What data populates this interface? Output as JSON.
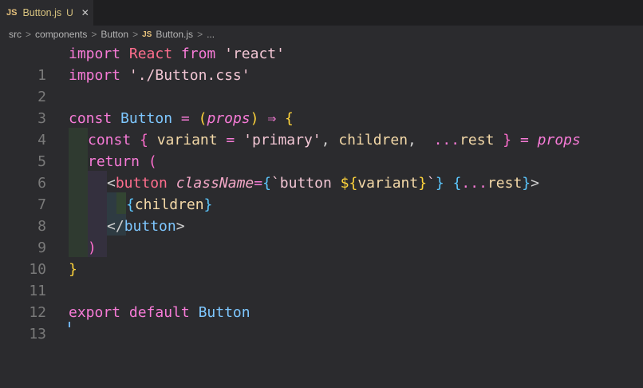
{
  "tab": {
    "badge": "JS",
    "label": "Button.js",
    "status": "U",
    "close": "✕"
  },
  "breadcrumb": [
    "src",
    "components",
    "Button"
  ],
  "breadcrumb_file": {
    "badge": "JS",
    "label": "Button.js",
    "tail": "..."
  },
  "line_numbers": [
    "1",
    "2",
    "3",
    "4",
    "5",
    "6",
    "7",
    "8",
    "9",
    "10",
    "11",
    "12",
    "13"
  ],
  "code": {
    "l1": {
      "import": "import",
      "react": "React",
      "from": "from",
      "mod": "'react'"
    },
    "l2": {
      "import": "import",
      "mod": "'./Button.css'"
    },
    "l4": {
      "const": "const",
      "name": "Button",
      "eq": "=",
      "open": "(",
      "param": "props",
      "close": ")",
      "arrow": "⇒",
      "brace": "{"
    },
    "l5": {
      "const": "const",
      "open": "{",
      "v1": "variant",
      "eq": "=",
      "v1val": "'primary'",
      "comma": ",",
      "v2": "children",
      "comma2": ",",
      "spread": "...",
      "v3": "rest",
      "close": "}",
      "eq2": "=",
      "param": "props"
    },
    "l6": {
      "return": "return",
      "open": "("
    },
    "l7": {
      "lt": "<",
      "tag": "button",
      "attr": "className",
      "eq": "=",
      "ob": "{",
      "tpl1": "`button ",
      "dollar": "$",
      "ib": "{",
      "var": "variant",
      "cb": "}",
      "tpl2": "`",
      "cb2": "}",
      "ob2": "{",
      "spread": "...",
      "rest": "rest",
      "cb3": "}",
      "gt": ">"
    },
    "l8": {
      "ob": "{",
      "var": "children",
      "cb": "}"
    },
    "l9": {
      "lt": "</",
      "tag": "button",
      "gt": ">"
    },
    "l10": {
      "close": ")"
    },
    "l11": {
      "close": "}"
    },
    "l13": {
      "export": "export",
      "default": "default",
      "name": "Button"
    }
  }
}
